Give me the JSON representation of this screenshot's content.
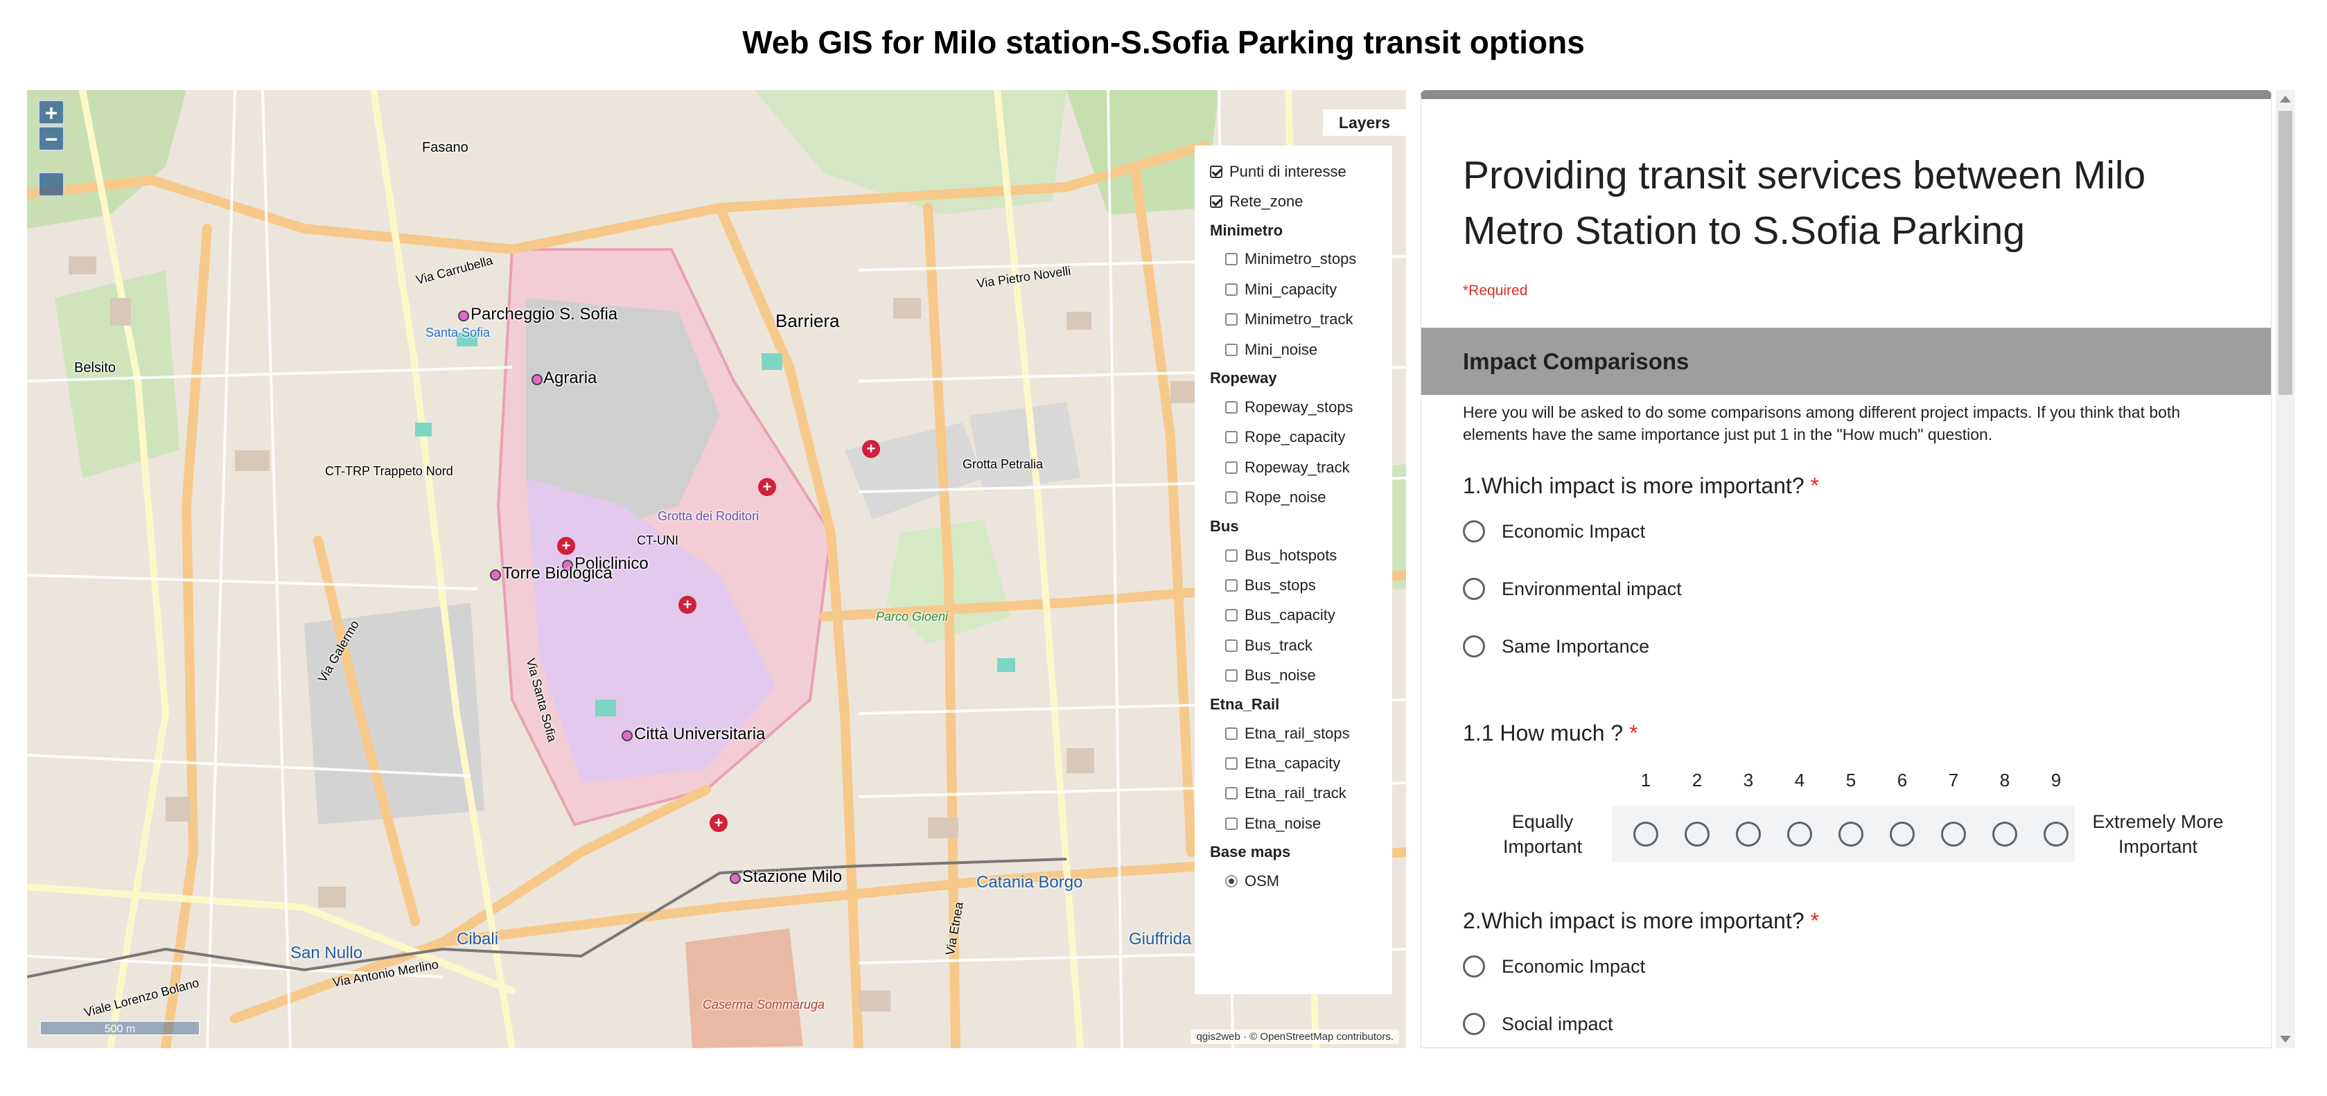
{
  "page": {
    "title": "Web GIS for Milo station-S.Sofia Parking transit options"
  },
  "map": {
    "zoom_in_label": "+",
    "zoom_out_label": "−",
    "scale_label": "500 m",
    "attribution": "qgis2web · © OpenStreetMap contributors.",
    "pois": [
      "Parcheggio S. Sofia",
      "Agraria",
      "Policlinico",
      "Torre Biologica",
      "Città Universitaria",
      "Stazione Milo"
    ],
    "place_labels": {
      "barriera": "Barriera",
      "catania_borgo": "Catania Borgo",
      "san_nullo": "San Nullo",
      "cibali": "Cibali",
      "giuffrida": "Giuffrida",
      "belsito": "Belsito",
      "fasano": "Fasano",
      "santa_sofia": "Santa Sofia",
      "grotta_petralia": "Grotta Petralia",
      "grotta_roditori": "Grotta dei Roditori",
      "parco_gioeni": "Parco Gioeni",
      "ct_trp": "CT-TRP Trappeto Nord",
      "ct_uni": "CT-UNI",
      "caserma": "Caserma Sommaruga",
      "via_carrubella": "Via Carrubella",
      "via_galermo": "Via Galermo",
      "viale_lorenzo_bolano": "Viale Lorenzo Bolano",
      "via_antonio_merlino": "Via Antonio Merlino",
      "via_etnea": "Via Etnea",
      "via_pietro_novelli": "Via Pietro Novelli",
      "via_santa_sofia": "Via Santa Sofia"
    }
  },
  "layers": {
    "tab_label": "Layers",
    "top_items": [
      {
        "label": "Punti di interesse",
        "checked": true
      },
      {
        "label": "Rete_zone",
        "checked": true
      }
    ],
    "groups": [
      {
        "name": "Minimetro",
        "items": [
          "Minimetro_stops",
          "Mini_capacity",
          "Minimetro_track",
          "Mini_noise"
        ]
      },
      {
        "name": "Ropeway",
        "items": [
          "Ropeway_stops",
          "Rope_capacity",
          "Ropeway_track",
          "Rope_noise"
        ]
      },
      {
        "name": "Bus",
        "items": [
          "Bus_hotspots",
          "Bus_stops",
          "Bus_capacity",
          "Bus_track",
          "Bus_noise"
        ]
      },
      {
        "name": "Etna_Rail",
        "items": [
          "Etna_rail_stops",
          "Etna_capacity",
          "Etna_rail_track",
          "Etna_noise"
        ]
      }
    ],
    "base_maps": {
      "name": "Base maps",
      "items": [
        {
          "label": "OSM",
          "selected": true
        }
      ]
    }
  },
  "form": {
    "title": "Providing transit services between Milo Metro Station to S.Sofia Parking",
    "required_note": "*Required",
    "section_title": "Impact Comparisons",
    "section_desc": "Here you will be asked to do some  comparisons among different project impacts. If you think that both elements have the same importance just put 1 in the \"How much\" question.",
    "q1": {
      "title": "1.Which impact is more important?",
      "options": [
        "Economic Impact",
        "Environmental impact",
        "Same Importance"
      ]
    },
    "q1_1": {
      "title": "1.1 How much ?",
      "scale": [
        "1",
        "2",
        "3",
        "4",
        "5",
        "6",
        "7",
        "8",
        "9"
      ],
      "low_label": "Equally Important",
      "high_label": "Extremely More Important"
    },
    "q2": {
      "title": "2.Which impact is more important?",
      "options": [
        "Economic Impact",
        "Social impact"
      ]
    },
    "required_star": "*"
  },
  "colors": {
    "form_accent": "#8b8b8b",
    "section_bg": "#9e9e9e",
    "required": "#d93025",
    "poi": "#e46ac8"
  }
}
